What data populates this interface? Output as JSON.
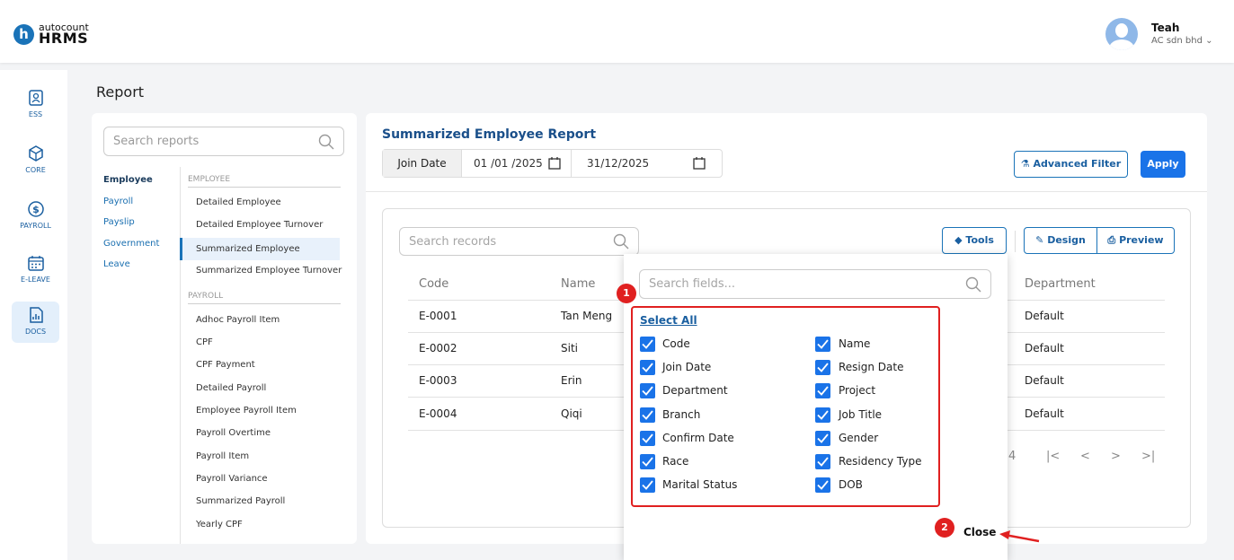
{
  "header": {
    "logo_top": "autocount",
    "logo_bottom": "HRMS",
    "user_name": "Teah",
    "user_org": "AC sdn bhd"
  },
  "nav": [
    {
      "label": "ESS"
    },
    {
      "label": "CORE"
    },
    {
      "label": "PAYROLL"
    },
    {
      "label": "E-LEAVE"
    },
    {
      "label": "DOCS"
    }
  ],
  "page_title": "Report",
  "sidebar": {
    "search_placeholder": "Search reports",
    "categories": [
      "Employee",
      "Payroll",
      "Payslip",
      "Government",
      "Leave"
    ],
    "sections": [
      {
        "header": "EMPLOYEE",
        "items": [
          "Detailed Employee",
          "Detailed Employee Turnover",
          "Summarized Employee",
          "Summarized Employee Turnover"
        ]
      },
      {
        "header": "PAYROLL",
        "items": [
          "Adhoc Payroll Item",
          "CPF",
          "CPF Payment",
          "Detailed Payroll",
          "Employee Payroll Item",
          "Payroll Overtime",
          "Payroll Item",
          "Payroll Variance",
          "Summarized Payroll",
          "Yearly CPF"
        ]
      }
    ]
  },
  "report": {
    "title": "Summarized Employee Report",
    "date_label": "Join Date",
    "date_from": "01 /01 /2025",
    "date_to": "31/12/2025",
    "advanced_filter": "Advanced Filter",
    "apply": "Apply",
    "records_placeholder": "Search records",
    "tools": "Tools",
    "design": "Design",
    "preview": "Preview",
    "columns": [
      "Code",
      "Name",
      "Department"
    ],
    "rows": [
      [
        "E-0001",
        "Tan Meng",
        "Default"
      ],
      [
        "E-0002",
        "Siti",
        "Default"
      ],
      [
        "E-0003",
        "Erin",
        "Default"
      ],
      [
        "E-0004",
        "Qiqi",
        "Default"
      ]
    ],
    "pager_num": "4",
    "pager_first": "|<",
    "pager_prev": "<",
    "pager_next": ">",
    "pager_last": ">|"
  },
  "fields_dropdown": {
    "search_placeholder": "Search fields...",
    "select_all": "Select All",
    "fields_left": [
      "Code",
      "Join Date",
      "Department",
      "Branch",
      "Confirm Date",
      "Race",
      "Marital Status"
    ],
    "fields_right": [
      "Name",
      "Resign Date",
      "Project",
      "Job Title",
      "Gender",
      "Residency Type",
      "DOB"
    ],
    "close": "Close"
  },
  "annotations": {
    "badge1": "1",
    "badge2": "2"
  },
  "colors": {
    "primary": "#1a73e8",
    "annotation": "#e02020"
  }
}
